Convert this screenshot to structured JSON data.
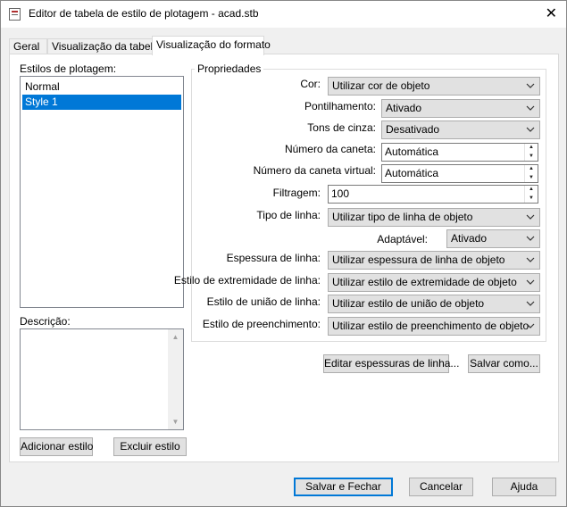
{
  "window": {
    "title": "Editor de tabela de estilo de plotagem - acad.stb",
    "close_glyph": "✕"
  },
  "tabs": [
    {
      "label": "Geral"
    },
    {
      "label": "Visualização da tabela"
    },
    {
      "label": "Visualização do formato"
    }
  ],
  "left": {
    "styles_label": "Estilos de plotagem:",
    "styles": [
      "Normal",
      "Style 1"
    ],
    "selected_style": "Style 1",
    "description_label": "Descrição:",
    "description_value": "",
    "add_button": "Adicionar estilo",
    "delete_button": "Excluir estilo"
  },
  "properties": {
    "group_title": "Propriedades",
    "color_label": "Cor:",
    "color_value": "Utilizar cor de objeto",
    "dither_label": "Pontilhamento:",
    "dither_value": "Ativado",
    "grayscale_label": "Tons de cinza:",
    "grayscale_value": "Desativado",
    "pen_label": "Número da caneta:",
    "pen_value": "Automática",
    "virtual_pen_label": "Número da caneta virtual:",
    "virtual_pen_value": "Automática",
    "screening_label": "Filtragem:",
    "screening_value": "100",
    "linetype_label": "Tipo de linha:",
    "linetype_value": "Utilizar tipo de linha de objeto",
    "adaptive_label": "Adaptável:",
    "adaptive_value": "Ativado",
    "lineweight_label": "Espessura de linha:",
    "lineweight_value": "Utilizar espessura de linha de objeto",
    "endstyle_label": "Estilo de extremidade de linha:",
    "endstyle_value": "Utilizar estilo de extremidade de objeto",
    "joinstyle_label": "Estilo de união de linha:",
    "joinstyle_value": "Utilizar estilo de união de objeto",
    "fillstyle_label": "Estilo de preenchimento:",
    "fillstyle_value": "Utilizar estilo de preenchimento de objeto",
    "edit_lineweights_button": "Editar espessuras de linha...",
    "save_as_button": "Salvar como..."
  },
  "footer": {
    "save_close_button": "Salvar e Fechar",
    "cancel_button": "Cancelar",
    "help_button": "Ajuda"
  },
  "colors": {
    "selection": "#0078d7",
    "button_face": "#e1e1e1",
    "dialog_bg": "#f0f0f0"
  }
}
